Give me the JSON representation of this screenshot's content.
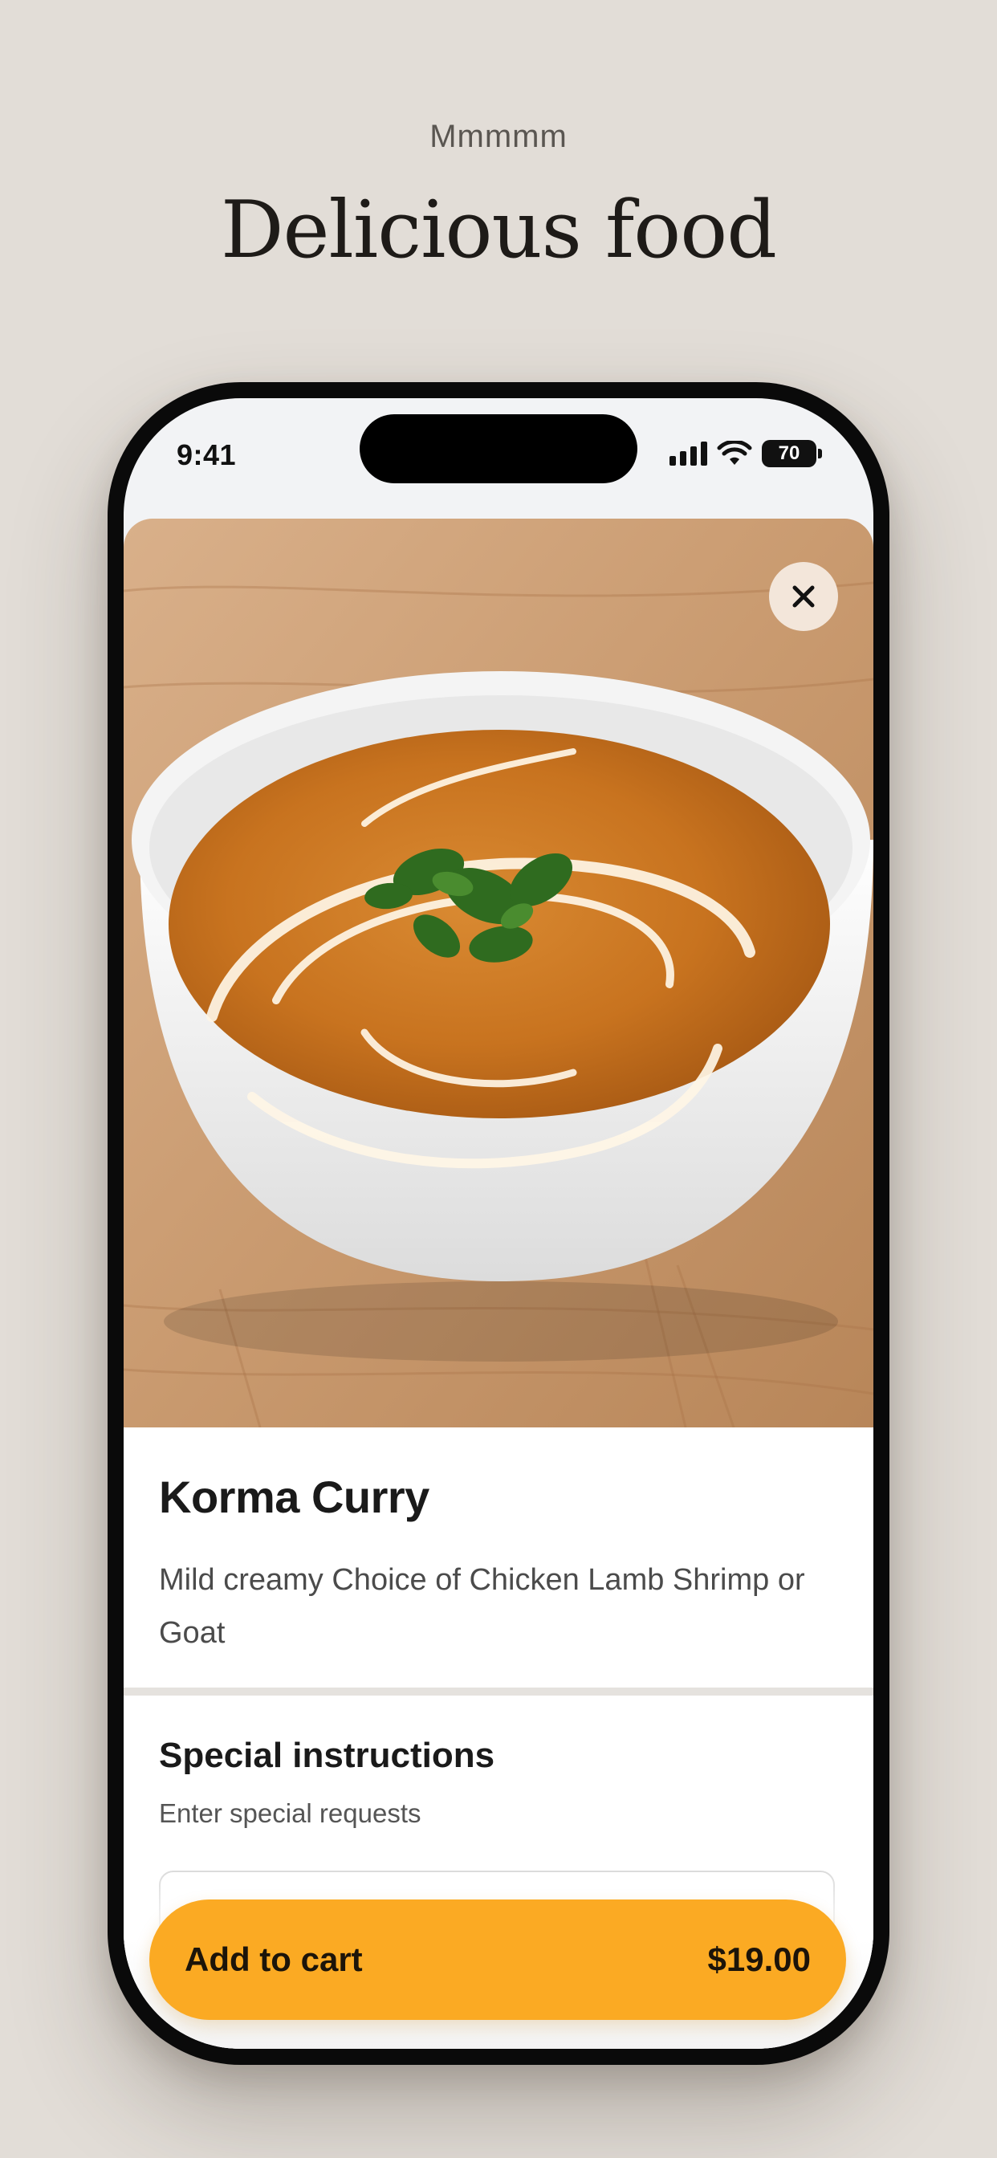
{
  "promo": {
    "eyebrow": "Mmmmm",
    "headline": "Delicious food"
  },
  "status_bar": {
    "time": "9:41",
    "battery": "70",
    "icons": [
      "cellular-signal-icon",
      "wifi-icon",
      "battery-icon"
    ]
  },
  "item": {
    "image_alt": "Bowl of korma curry garnished with cream and cilantro",
    "close_icon": "close-icon",
    "name": "Korma Curry",
    "description": "Mild creamy Choice of Chicken Lamb Shrimp or Goat"
  },
  "special_instructions": {
    "title": "Special instructions",
    "subtitle": "Enter special requests",
    "value": ""
  },
  "cart_button": {
    "label": "Add to cart",
    "price": "$19.00"
  },
  "colors": {
    "background": "#e2ddd7",
    "accent": "#fbaa23",
    "close_button": "#f3e6da"
  }
}
